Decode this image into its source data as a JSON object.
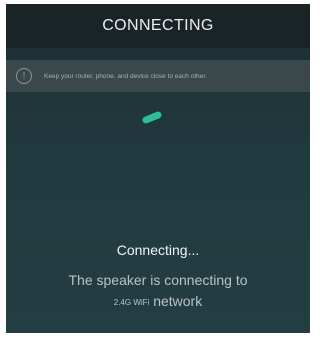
{
  "header": {
    "title": "CONNECTING"
  },
  "notice": {
    "icon": "info-icon",
    "icon_glyph": "!",
    "text": "Keep your router, phone, and device close to each other."
  },
  "spinner": {
    "icon": "loading-spinner-icon",
    "color": "#2fbf94"
  },
  "status": {
    "title": "Connecting...",
    "description": "The speaker is connecting to",
    "network_band": "2.4G WiFi",
    "network_word": "network"
  },
  "colors": {
    "header_bg": "#1a2326",
    "notice_bg": "#3a474b",
    "body_bg": "#213a3f",
    "accent": "#2fbf94"
  }
}
